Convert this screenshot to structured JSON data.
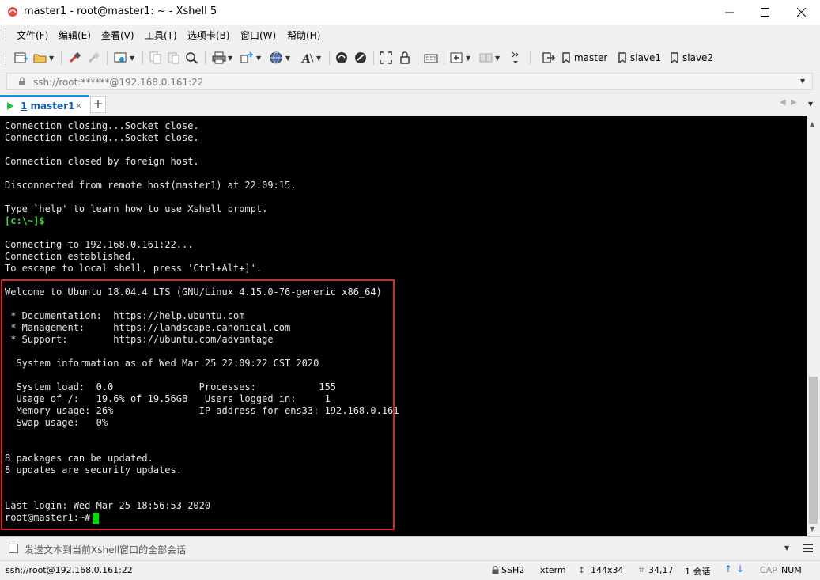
{
  "window": {
    "title": "master1 - root@master1: ~ - Xshell 5",
    "minimize": "minimize",
    "maximize": "maximize",
    "close": "close"
  },
  "menu": [
    "文件(F)",
    "编辑(E)",
    "查看(V)",
    "工具(T)",
    "选项卡(B)",
    "窗口(W)",
    "帮助(H)"
  ],
  "toolbar": {
    "bookmarks": [
      "master",
      "slave1",
      "slave2"
    ]
  },
  "address": {
    "value": "ssh://root:******@192.168.0.161:22"
  },
  "tab": {
    "number": "1",
    "name": "master1",
    "close": "×",
    "add": "+"
  },
  "terminal": {
    "lines": [
      "Connection closing...Socket close.",
      "Connection closing...Socket close.",
      "",
      "Connection closed by foreign host.",
      "",
      "Disconnected from remote host(master1) at 22:09:15.",
      "",
      "Type `help' to learn how to use Xshell prompt.",
      "[c:\\~]$",
      "",
      "Connecting to 192.168.0.161:22...",
      "Connection established.",
      "To escape to local shell, press 'Ctrl+Alt+]'.",
      "",
      "Welcome to Ubuntu 18.04.4 LTS (GNU/Linux 4.15.0-76-generic x86_64)",
      "",
      " * Documentation:  https://help.ubuntu.com",
      " * Management:     https://landscape.canonical.com",
      " * Support:        https://ubuntu.com/advantage",
      "",
      "  System information as of Wed Mar 25 22:09:22 CST 2020",
      "",
      "  System load:  0.0               Processes:           155",
      "  Usage of /:   19.6% of 19.56GB   Users logged in:     1",
      "  Memory usage: 26%               IP address for ens33: 192.168.0.161",
      "  Swap usage:   0%",
      "",
      "",
      "8 packages can be updated.",
      "8 updates are security updates.",
      "",
      "",
      "Last login: Wed Mar 25 18:56:53 2020",
      "root@master1:~# "
    ]
  },
  "sendbar": {
    "text": "发送文本到当前Xshell窗口的全部会话"
  },
  "status": {
    "connection": "ssh://root@192.168.0.161:22",
    "protocol": "SSH2",
    "terminal_type": "xterm",
    "size": "144x34",
    "cursor_pos": "34,17",
    "sessions": "1 会话",
    "caps": "CAP",
    "num": "NUM"
  },
  "colors": {
    "terminal_bg": "#000000",
    "terminal_fg": "#e6e6e6",
    "prompt_green": "#3cd73c",
    "highlight_red": "#d9262c",
    "tab_accent": "#1a8cd8"
  }
}
